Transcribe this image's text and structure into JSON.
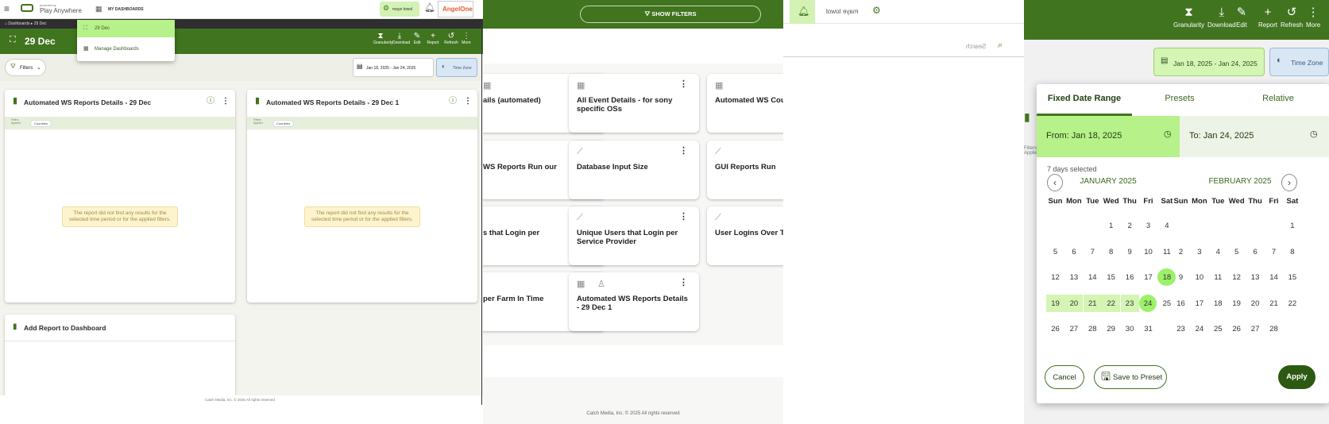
{
  "panel1": {
    "brand_small": "powered by",
    "brand_name": "Play Anywhere",
    "my_dashboards": "MY DASHBOARDS",
    "user_chip": "maye towol",
    "partner_logo": "AngelOne",
    "breadcrumb_root": "Dashboards",
    "breadcrumb_current": "29 Dec",
    "dashboard_title": "29 Dec",
    "dropdown_items": [
      "29 Dec",
      "Manage Dashboards"
    ],
    "toolbar": [
      "Granularity",
      "Download",
      "Edit",
      "Report",
      "Refresh",
      "More"
    ],
    "filters_label": "Filters",
    "date_range": "Jan 18, 2025 - Jan 24, 2025",
    "time_zone": "Time Zone",
    "cards": [
      {
        "title": "Automated WS Reports Details - 29 Dec",
        "filters_label": "Filters Applied",
        "chip": "Countries",
        "message": "The report did not find any results for the selected time period or for the applied filters."
      },
      {
        "title": "Automated WS Reports Details - 29 Dec 1",
        "filters_label": "Filters Applied",
        "chip": "Countries",
        "message": "The report did not find any results for the selected time period or for the applied filters."
      }
    ],
    "add_report": "Add Report to Dashboard",
    "footer": "Catch Media, Inc. © 2025 All rights reserved"
  },
  "panel2": {
    "show_filters": "SHOW FILTERS",
    "cards": [
      {
        "title": "ails (automated)",
        "icon": "table-icon"
      },
      {
        "title": "All Event Details - for sony specific OSs",
        "icon": "table-icon"
      },
      {
        "title": "Automated WS Cou Report",
        "icon": "table-icon"
      },
      {
        "title": "WS Reports Run our",
        "icon": "line-chart-icon"
      },
      {
        "title": "Database Input Size",
        "icon": "line-chart-icon"
      },
      {
        "title": "GUI Reports Run",
        "icon": "line-chart-icon"
      },
      {
        "title": "s that Login per",
        "icon": "line-chart-icon"
      },
      {
        "title": "Unique Users that Login per Service Provider",
        "icon": "line-chart-icon"
      },
      {
        "title": "User Logins Over T Sonyliv",
        "icon": "line-chart-icon"
      },
      {
        "title": "per Farm In Time",
        "icon": "line-chart-icon"
      },
      {
        "title": "Automated WS Reports Details - 29 Dec 1",
        "icon": "table-icon"
      }
    ],
    "footer": "Catch Media, Inc. © 2025 All rights reserved"
  },
  "panel3": {
    "user_name": "maye towol",
    "search_placeholder": "Search"
  },
  "panel4": {
    "toolbar": [
      "Granularity",
      "Download",
      "Edit",
      "Report",
      "Refresh",
      "More"
    ],
    "date_range": "Jan 18, 2025 - Jan 24, 2025",
    "time_zone": "Time Zone",
    "side_labels": "Filters Applie",
    "tabs": [
      "Fixed Date Range",
      "Presets",
      "Relative"
    ],
    "from_label": "From:",
    "from_value": "Jan 18, 2025",
    "to_label": "To:",
    "to_value": "Jan 24, 2025",
    "days_selected": "7 days selected",
    "months": [
      "JANUARY 2025",
      "FEBRUARY 2025"
    ],
    "weekdays": [
      "Sun",
      "Mon",
      "Tue",
      "Wed",
      "Thu",
      "Fri",
      "Sat"
    ],
    "jan_days": [
      [
        "",
        "",
        "",
        "1",
        "2",
        "3",
        "4"
      ],
      [
        "5",
        "6",
        "7",
        "8",
        "9",
        "10",
        "11"
      ],
      [
        "12",
        "13",
        "14",
        "15",
        "16",
        "17",
        "18"
      ],
      [
        "19",
        "20",
        "21",
        "22",
        "23",
        "24",
        "25"
      ],
      [
        "26",
        "27",
        "28",
        "29",
        "30",
        "31",
        ""
      ]
    ],
    "feb_days": [
      [
        "",
        "",
        "",
        "",
        "",
        "",
        "1"
      ],
      [
        "2",
        "3",
        "4",
        "5",
        "6",
        "7",
        "8"
      ],
      [
        "9",
        "10",
        "11",
        "12",
        "13",
        "14",
        "15"
      ],
      [
        "16",
        "17",
        "18",
        "19",
        "20",
        "21",
        "22"
      ],
      [
        "23",
        "24",
        "25",
        "26",
        "27",
        "28",
        ""
      ]
    ],
    "range_start": "18",
    "range_end": "24",
    "cancel": "Cancel",
    "save_preset": "Save to Preset",
    "apply": "Apply"
  },
  "colors": {
    "brand_green": "#41741f",
    "light_green": "#b6f18a",
    "range_green": "#d4f5b3"
  }
}
